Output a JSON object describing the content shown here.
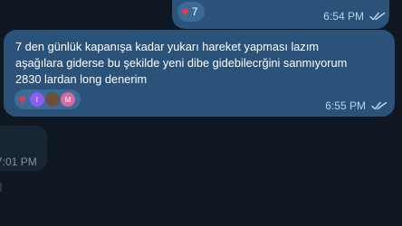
{
  "messages": {
    "top_outgoing": {
      "reaction_icon": "heart-icon",
      "reaction_count": "7",
      "time": "6:54 PM",
      "status_icon": "double-check-icon"
    },
    "main_outgoing": {
      "text": "7 den günlük kapanışa kadar yukarı hareket yapması lazım\naşağılara giderse bu şekilde yeni dibe gidebilecrğini sanmıyorum\n2830 lardan long denerim",
      "reaction_icon": "heart-icon",
      "reactor_initials": [
        "I",
        "",
        "M"
      ],
      "time": "6:55 PM",
      "status_icon": "double-check-icon"
    },
    "incoming": {
      "time": "7:01 PM"
    }
  },
  "colors": {
    "background": "#0e1621",
    "outgoing_bubble": "#2b5278",
    "incoming_bubble": "#182533",
    "heart": "#e53a4a",
    "time_out": "#b8d3ee",
    "time_in": "#8094a8"
  }
}
